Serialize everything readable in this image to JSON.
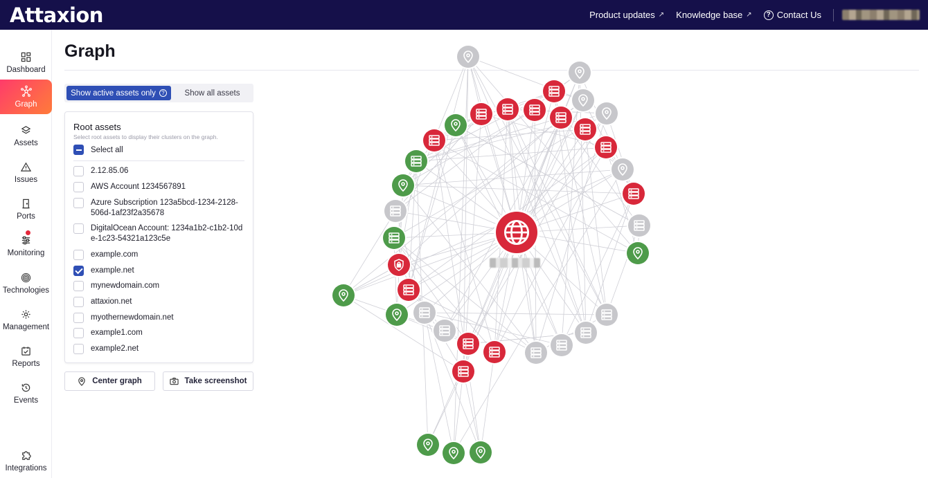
{
  "app": {
    "logo": "Attaxion"
  },
  "topbar": {
    "product_updates": "Product updates",
    "knowledge_base": "Knowledge base",
    "contact_us": "Contact Us"
  },
  "sidebar": {
    "items": [
      {
        "label": "Dashboard",
        "icon": "dashboard-icon"
      },
      {
        "label": "Graph",
        "icon": "graph-icon",
        "active": true
      },
      {
        "label": "Assets",
        "icon": "layers-icon"
      },
      {
        "label": "Issues",
        "icon": "warning-icon"
      },
      {
        "label": "Ports",
        "icon": "door-icon"
      },
      {
        "label": "Monitoring",
        "icon": "sliders-icon",
        "badge": true
      },
      {
        "label": "Technologies",
        "icon": "fingerprint-icon"
      },
      {
        "label": "Management",
        "icon": "gear-icon"
      },
      {
        "label": "Reports",
        "icon": "report-icon"
      },
      {
        "label": "Events",
        "icon": "history-icon"
      },
      {
        "label": "Integrations",
        "icon": "puzzle-icon"
      }
    ]
  },
  "main": {
    "title": "Graph",
    "toggle": {
      "active_label": "Show active assets only",
      "all_label": "Show all assets",
      "selected": "active"
    },
    "root_assets": {
      "title": "Root assets",
      "subtitle": "Select root assets to display their clusters on the graph.",
      "select_all": "Select all",
      "items": [
        {
          "label": "2.12.85.06",
          "checked": false
        },
        {
          "label": "AWS Account 1234567891",
          "checked": false
        },
        {
          "label": "Azure Subscription 123a5bcd-1234-2128-506d-1af23f2a35678",
          "checked": false
        },
        {
          "label": "DigitalOcean Account: 1234a1b2-c1b2-10de-1c23-54321a123c5e",
          "checked": false
        },
        {
          "label": "example.com",
          "checked": false
        },
        {
          "label": "example.net",
          "checked": true
        },
        {
          "label": "mynewdomain.com",
          "checked": false
        },
        {
          "label": "attaxion.net",
          "checked": false
        },
        {
          "label": "myothernewdomain.net",
          "checked": false
        },
        {
          "label": "example1.com",
          "checked": false
        },
        {
          "label": "example2.net",
          "checked": false
        }
      ]
    },
    "center_graph": "Center graph",
    "take_screenshot": "Take screenshot"
  },
  "colors": {
    "nav": "#15104a",
    "accent": "#2f4fb5",
    "danger": "#d8283a",
    "ok": "#4e9b4a",
    "muted": "#c7c7cb"
  }
}
